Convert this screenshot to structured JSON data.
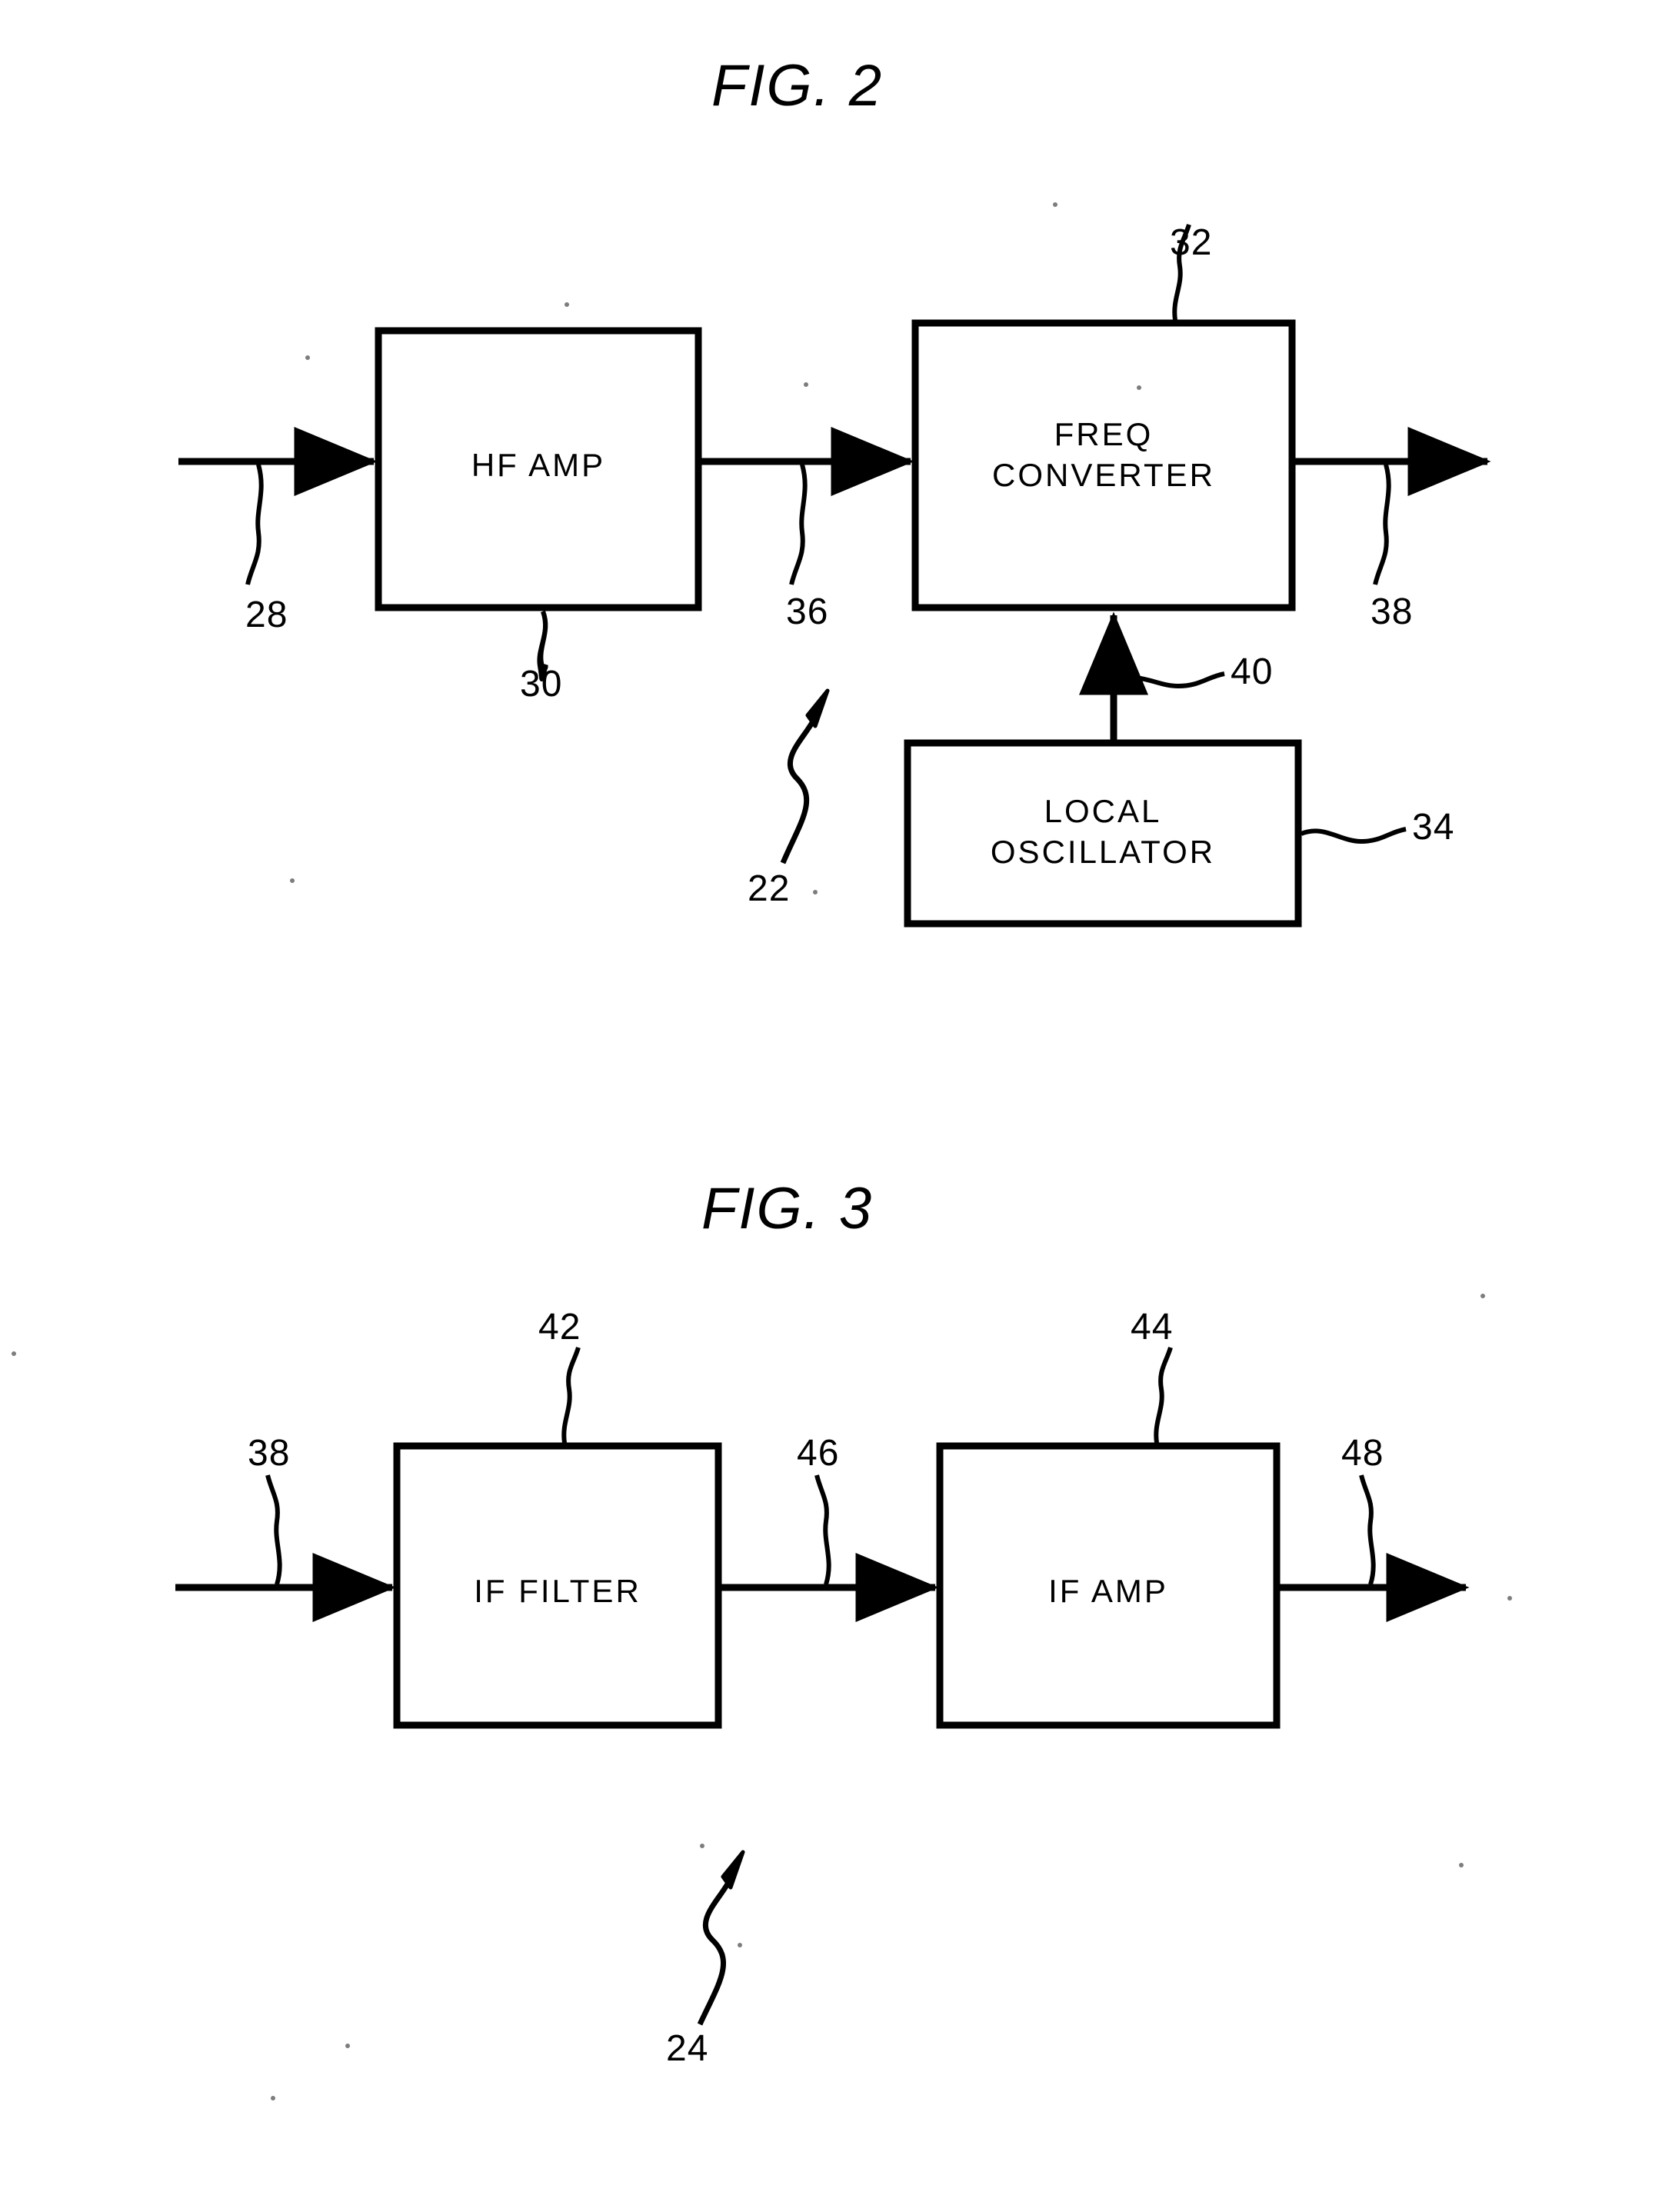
{
  "document": {
    "type": "patent-drawing-sheet",
    "background_color": "#ffffff",
    "ink_color": "#000000"
  },
  "figures": [
    {
      "id": "fig2",
      "title": "FIG. 2",
      "assembly_ref": "22",
      "blocks": [
        {
          "id": "hf-amp",
          "label": "HF  AMP",
          "ref": "30",
          "ref_position": "below"
        },
        {
          "id": "freq-converter",
          "label": "FREQ\nCONVERTER",
          "ref": "32",
          "ref_position": "above"
        },
        {
          "id": "local-oscillator",
          "label": "LOCAL\nOSCILLATOR",
          "ref": "34",
          "ref_position": "right"
        }
      ],
      "signals": [
        {
          "id": "sig-28",
          "ref": "28",
          "from": "input",
          "to": "hf-amp",
          "ref_position": "below"
        },
        {
          "id": "sig-36",
          "ref": "36",
          "from": "hf-amp",
          "to": "freq-converter",
          "ref_position": "below"
        },
        {
          "id": "sig-38",
          "ref": "38",
          "from": "freq-converter",
          "to": "output",
          "ref_position": "below"
        },
        {
          "id": "sig-40",
          "ref": "40",
          "from": "local-oscillator",
          "to": "freq-converter",
          "ref_position": "right"
        }
      ]
    },
    {
      "id": "fig3",
      "title": "FIG. 3",
      "assembly_ref": "24",
      "blocks": [
        {
          "id": "if-filter",
          "label": "IF  FILTER",
          "ref": "42",
          "ref_position": "above"
        },
        {
          "id": "if-amp",
          "label": "IF  AMP",
          "ref": "44",
          "ref_position": "above"
        }
      ],
      "signals": [
        {
          "id": "sig-38b",
          "ref": "38",
          "from": "input",
          "to": "if-filter",
          "ref_position": "above"
        },
        {
          "id": "sig-46",
          "ref": "46",
          "from": "if-filter",
          "to": "if-amp",
          "ref_position": "above"
        },
        {
          "id": "sig-48",
          "ref": "48",
          "from": "if-amp",
          "to": "output",
          "ref_position": "above"
        }
      ]
    }
  ],
  "fig2": {
    "title": "FIG. 2",
    "hf_amp_label": "HF  AMP",
    "freq_converter_line1": "FREQ",
    "freq_converter_line2": "CONVERTER",
    "local_oscillator_line1": "LOCAL",
    "local_oscillator_line2": "OSCILLATOR",
    "ref_22": "22",
    "ref_28": "28",
    "ref_30": "30",
    "ref_32": "32",
    "ref_34": "34",
    "ref_36": "36",
    "ref_38": "38",
    "ref_40": "40"
  },
  "fig3": {
    "title": "FIG. 3",
    "if_filter_label": "IF  FILTER",
    "if_amp_label": "IF  AMP",
    "ref_24": "24",
    "ref_38": "38",
    "ref_42": "42",
    "ref_44": "44",
    "ref_46": "46",
    "ref_48": "48"
  }
}
